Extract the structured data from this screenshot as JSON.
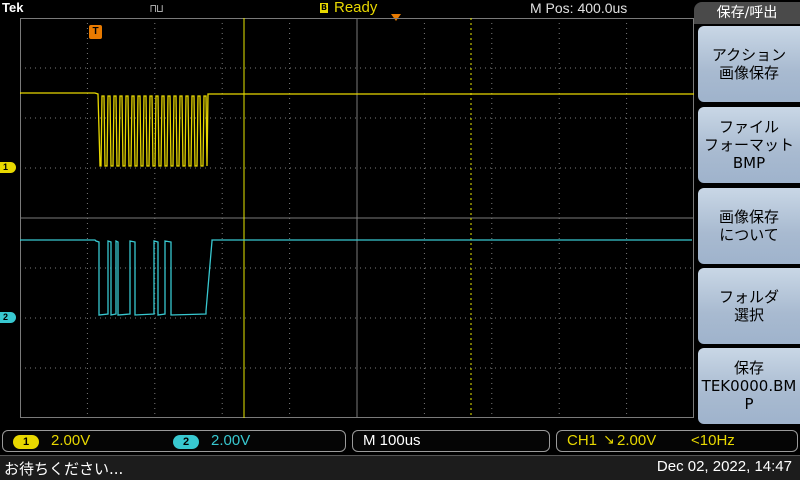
{
  "header": {
    "brand": "Tek",
    "run_glyph": "⊓⊔",
    "status_icon": "B",
    "status": "Ready",
    "horizontal_position": "M Pos: 400.0us",
    "trigger_marker": "T"
  },
  "channels": [
    {
      "id": "1",
      "color": "#e8d800"
    },
    {
      "id": "2",
      "color": "#38c8d0"
    }
  ],
  "menu": {
    "title": "保存/呼出",
    "buttons": [
      {
        "label": "アクション\n画像保存"
      },
      {
        "label": "ファイル\nフォーマット\nBMP"
      },
      {
        "label": "画像保存\nについて"
      },
      {
        "label": "フォルダ\n選択"
      },
      {
        "label": "保存\nTEK0000.BM\nP"
      }
    ]
  },
  "readouts": {
    "ch1_chip": "1",
    "ch1_scale": "2.00V",
    "ch2_chip": "2",
    "ch2_scale": "2.00V",
    "timebase": "M 100us",
    "trigger_source": "CH1",
    "trigger_slope": "↘",
    "trigger_level": "2.00V",
    "trigger_freq": "<10Hz"
  },
  "message": "お待ちください...",
  "datetime": "Dec 02, 2022, 14:47",
  "colors": {
    "grid": "#7a7a7a",
    "ch1": "#e8d800",
    "ch2": "#38c8d0",
    "trigger": "#e87a00",
    "cursor": "#e8e800"
  }
}
